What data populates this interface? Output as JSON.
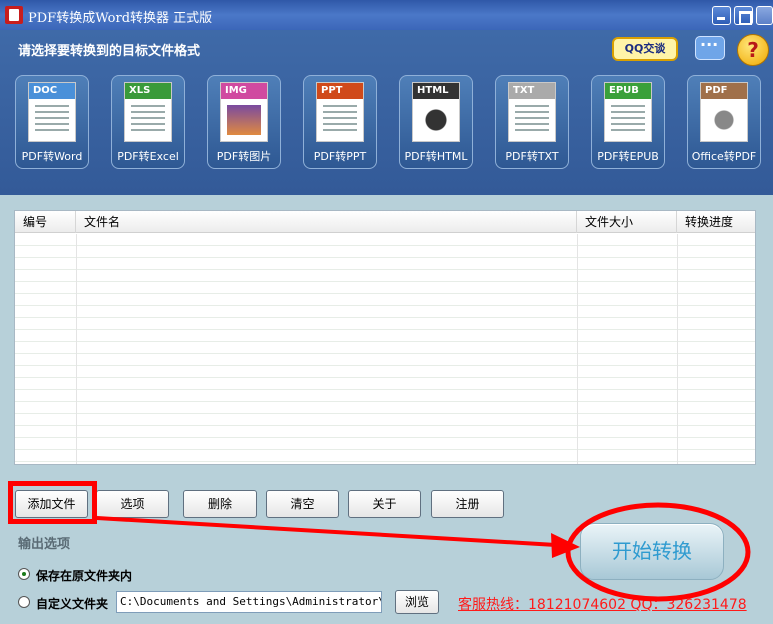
{
  "window": {
    "title": "PDF转换成Word转换器 正式版"
  },
  "header": {
    "prompt": "请选择要转换到的目标文件格式",
    "qq_badge": "QQ交谈",
    "help_glyph": "?"
  },
  "formats": [
    {
      "tag": "DOC",
      "label": "PDF转Word",
      "color": "#4a90d9"
    },
    {
      "tag": "XLS",
      "label": "PDF转Excel",
      "color": "#3a9a3a"
    },
    {
      "tag": "IMG",
      "label": "PDF转图片",
      "color": "#d04aa0"
    },
    {
      "tag": "PPT",
      "label": "PDF转PPT",
      "color": "#d04a1a"
    },
    {
      "tag": "HTML",
      "label": "PDF转HTML",
      "color": "#333333"
    },
    {
      "tag": "TXT",
      "label": "PDF转TXT",
      "color": "#aaaaaa"
    },
    {
      "tag": "EPUB",
      "label": "PDF转EPUB",
      "color": "#3aa03a"
    },
    {
      "tag": "PDF",
      "label": "Office转PDF",
      "color": "#a0704a"
    }
  ],
  "table": {
    "columns": [
      "编号",
      "文件名",
      "文件大小",
      "转换进度"
    ],
    "rows": []
  },
  "toolbar": {
    "add": "添加文件",
    "options": "选项",
    "delete": "删除",
    "clear": "清空",
    "about": "关于",
    "register": "注册"
  },
  "output": {
    "title": "输出选项",
    "save_original": "保存在原文件夹内",
    "custom_folder": "自定义文件夹",
    "path": "C:\\Documents and Settings\\Administrator\\桌面",
    "browse": "浏览",
    "selected": "save_original"
  },
  "start_button": "开始转换",
  "hotline": "客服热线：18121074602 QQ：326231478",
  "annotation_color": "#ff0000"
}
